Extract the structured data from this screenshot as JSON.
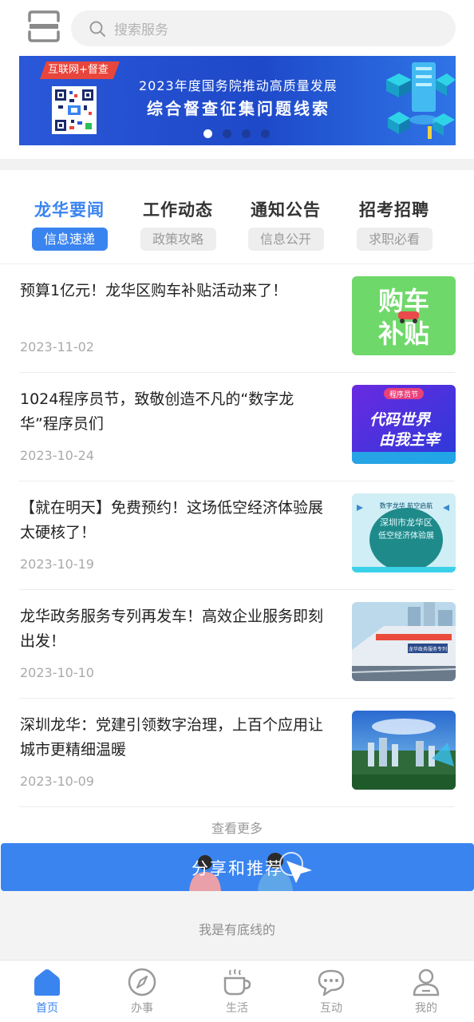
{
  "header": {
    "search_placeholder": "搜索服务"
  },
  "banner": {
    "tag": "互联网+督查",
    "line1": "2023年度国务院推动高质量发展",
    "line2": "综合督查征集问题线索",
    "active_dot": 0,
    "dot_count": 4
  },
  "tabs": [
    {
      "label": "龙华要闻",
      "sub": "信息速递",
      "active": true
    },
    {
      "label": "工作动态",
      "sub": "政策攻略",
      "active": false
    },
    {
      "label": "通知公告",
      "sub": "信息公开",
      "active": false
    },
    {
      "label": "招考招聘",
      "sub": "求职必看",
      "active": false
    }
  ],
  "news": [
    {
      "title": "预算1亿元！龙华区购车补贴活动来了！",
      "date": "2023-11-02",
      "thumb_text": [
        "购车",
        "补贴"
      ]
    },
    {
      "title": "1024程序员节，致敬创造不凡的“数字龙华”程序员们",
      "date": "2023-10-24",
      "thumb_text": [
        "程序员节",
        "代码世界",
        "由我主宰"
      ]
    },
    {
      "title": "【就在明天】免费预约！这场低空经济体验展太硬核了！",
      "date": "2023-10-19",
      "thumb_text": [
        "数字龙华 航空启航",
        "深圳市龙华区",
        "低空经济体验展"
      ]
    },
    {
      "title": "龙华政务服务专列再发车！高效企业服务即刻出发！",
      "date": "2023-10-10",
      "thumb_text": [
        "龙华政务服务专列"
      ]
    },
    {
      "title": "深圳龙华：党建引领数字治理，上百个应用让城市更精细温暖",
      "date": "2023-10-09",
      "thumb_text": []
    }
  ],
  "more_label": "查看更多",
  "share_label": "分享和推荐",
  "bottom_line": "我是有底线的",
  "tabbar": [
    {
      "label": "首页",
      "icon": "home-icon",
      "active": true
    },
    {
      "label": "办事",
      "icon": "compass-icon",
      "active": false
    },
    {
      "label": "生活",
      "icon": "coffee-icon",
      "active": false
    },
    {
      "label": "互动",
      "icon": "chat-icon",
      "active": false
    },
    {
      "label": "我的",
      "icon": "user-icon",
      "active": false
    }
  ],
  "colors": {
    "accent": "#3a84f0",
    "banner_blue": "#2a58d8",
    "tag_red": "#e8463c",
    "text_main": "#222222",
    "text_muted": "#aaaaaa"
  }
}
